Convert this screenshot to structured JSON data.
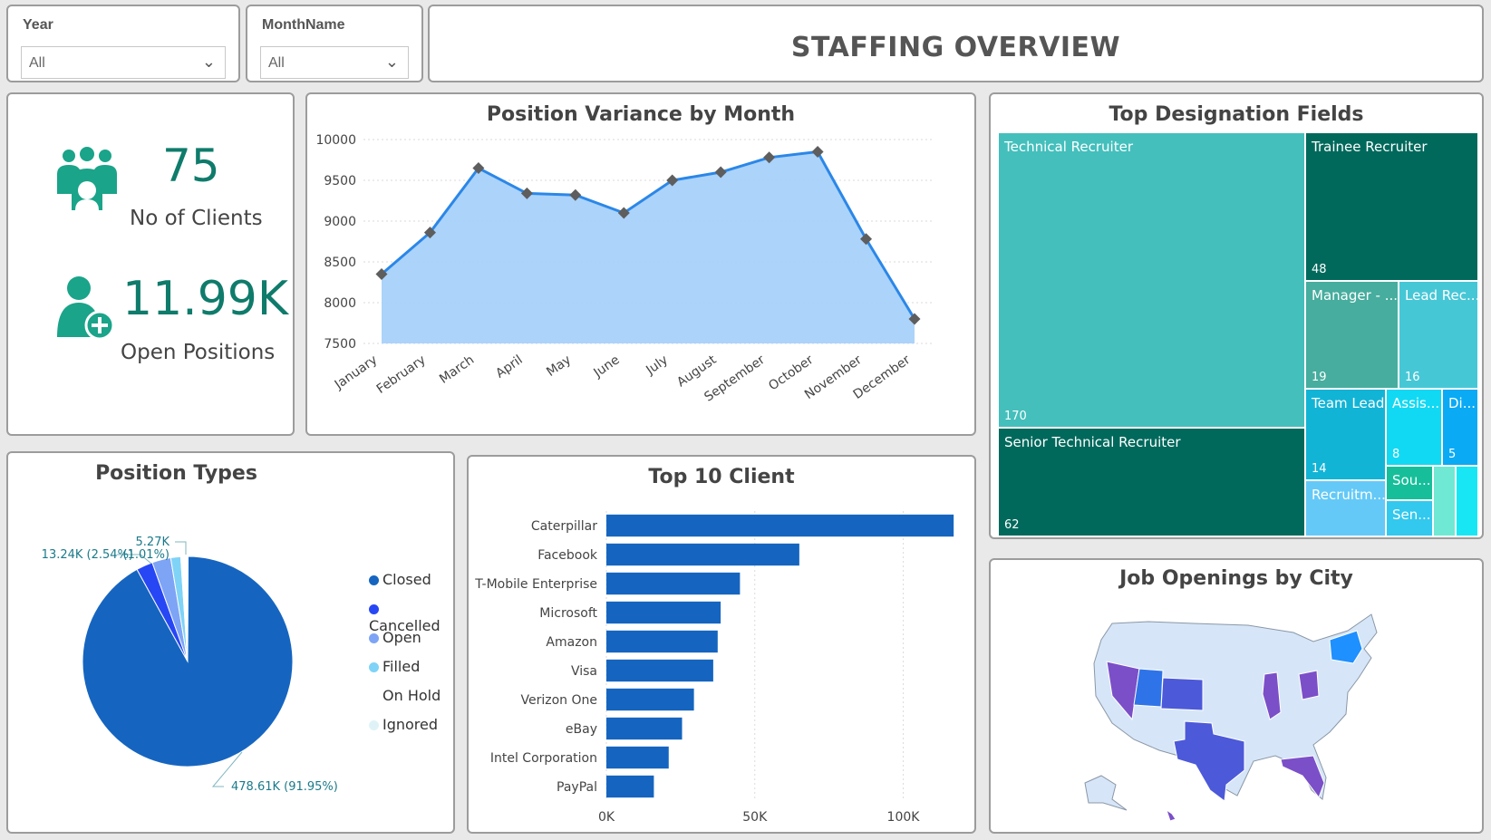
{
  "filters": {
    "year": {
      "label": "Year",
      "value": "All"
    },
    "month": {
      "label": "MonthName",
      "value": "All"
    }
  },
  "header": {
    "title": "STAFFING OVERVIEW"
  },
  "kpis": {
    "clients": {
      "value": "75",
      "label": "No of Clients",
      "icon": "group-people-icon"
    },
    "open_positions": {
      "value": "11.99K",
      "label": "Open Positions",
      "icon": "add-person-icon"
    }
  },
  "colors": {
    "teal": "#1aa489",
    "area_fill": "#a8d1fa",
    "line": "#2b87e8",
    "marker": "#5e5e5e",
    "bar": "#1565c0"
  },
  "chart_data": [
    {
      "type": "area",
      "title": "Position Variance by Month",
      "categories": [
        "January",
        "February",
        "March",
        "April",
        "May",
        "June",
        "July",
        "August",
        "September",
        "October",
        "November",
        "December"
      ],
      "values": [
        8350,
        8860,
        9650,
        9340,
        9320,
        9100,
        9500,
        9600,
        9780,
        9850,
        8780,
        7800
      ],
      "ylim": [
        7500,
        10000
      ],
      "yticks": [
        "10000",
        "9500",
        "9000",
        "8500",
        "8000",
        "7500"
      ],
      "grid": true
    },
    {
      "type": "pie",
      "title": "Position Types",
      "slices": [
        {
          "label": "Closed",
          "value": 478610,
          "data_label": "478.61K (91.95%)",
          "color": "#1565c0"
        },
        {
          "label": "Cancelled",
          "value": 13240,
          "data_label": "13.24K (2.54%)",
          "color": "#2747f5"
        },
        {
          "label": "Open",
          "value": 15000,
          "data_label": "",
          "color": "#7ea4f5"
        },
        {
          "label": "Filled",
          "value": 8000,
          "data_label": "",
          "color": "#7ed3f7"
        },
        {
          "label": "On Hold",
          "value": 5270,
          "data_label": "5.27K (1.01%)",
          "color": "#ffffff"
        },
        {
          "label": "Ignored",
          "value": 500,
          "data_label": "",
          "color": "#dff3f7"
        }
      ],
      "legend": "right"
    },
    {
      "type": "bar",
      "title": "Top 10 Client",
      "orientation": "horizontal",
      "categories": [
        "Caterpillar",
        "Facebook",
        "T-Mobile Enterprise",
        "Microsoft",
        "Amazon",
        "Visa",
        "Verizon One",
        "eBay",
        "Intel Corporation",
        "PayPal"
      ],
      "values": [
        117000,
        65000,
        45000,
        38500,
        37500,
        36000,
        29500,
        25500,
        21000,
        16000
      ],
      "xlim": [
        0,
        120000
      ],
      "xticks": [
        "0K",
        "50K",
        "100K"
      ],
      "grid": true
    },
    {
      "type": "treemap",
      "title": "Top Designation Fields",
      "items": [
        {
          "label": "Technical Recruiter",
          "value": "170",
          "color": "#44bfbc"
        },
        {
          "label": "Senior Technical Recruiter",
          "value": "62",
          "color": "#00695c"
        },
        {
          "label": "Trainee Recruiter",
          "value": "48",
          "color": "#00695c"
        },
        {
          "label": "Manager - ...",
          "value": "19",
          "color": "#47ad9e"
        },
        {
          "label": "Lead Rec...",
          "value": "16",
          "color": "#46c7d6"
        },
        {
          "label": "Team Lead",
          "value": "14",
          "color": "#12b4d6"
        },
        {
          "label": "Assis...",
          "value": "8",
          "color": "#12d9f3"
        },
        {
          "label": "Di...",
          "value": "5",
          "color": "#0aaaf5"
        },
        {
          "label": "Recruitm...",
          "value": "",
          "color": "#64c9f7"
        },
        {
          "label": "Sou...",
          "value": "",
          "color": "#16bf9a"
        },
        {
          "label": "Sen...",
          "value": "",
          "color": "#33c8ee"
        },
        {
          "label": "",
          "value": "",
          "color": "#6fe9d3"
        },
        {
          "label": "",
          "value": "",
          "color": "#19e6f5"
        }
      ]
    }
  ],
  "map": {
    "title": "Job Openings by City",
    "highlighted": [
      "Nevada",
      "Utah",
      "Colorado",
      "Texas",
      "Illinois",
      "Ohio",
      "New York",
      "Florida",
      "Hawaii"
    ]
  }
}
